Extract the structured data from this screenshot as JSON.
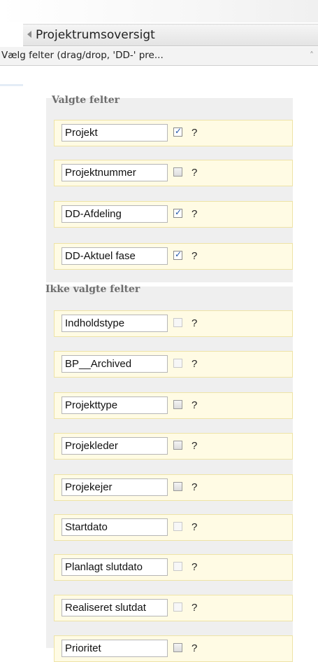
{
  "pane": {
    "title": "Projektrumsoversigt",
    "subtitle": "Vælg felter (drag/drop, 'DD-' pre..."
  },
  "selected_section": {
    "label": "Valgte felter",
    "fields": [
      {
        "name": "Projekt",
        "checked": true
      },
      {
        "name": "Projektnummer",
        "checked": false
      },
      {
        "name": "DD-Afdeling",
        "checked": true
      },
      {
        "name": "DD-Aktuel fase",
        "checked": true
      }
    ]
  },
  "unselected_section": {
    "label": "Ikke valgte felter",
    "fields": [
      {
        "name": "Indholdstype",
        "checked": false,
        "disabled": true
      },
      {
        "name": "BP__Archived",
        "checked": false,
        "disabled": true
      },
      {
        "name": "Projekttype",
        "checked": false
      },
      {
        "name": "Projekleder",
        "checked": false
      },
      {
        "name": "Projekejer",
        "checked": false
      },
      {
        "name": "Startdato",
        "checked": false,
        "disabled": true
      },
      {
        "name": "Planlagt slutdato",
        "checked": false,
        "disabled": true
      },
      {
        "name": "Realiseret slutdat",
        "checked": false,
        "disabled": true
      },
      {
        "name": "Prioritet",
        "checked": false
      }
    ]
  },
  "help_label": "?",
  "colors": {
    "row_background": "#fffbe4",
    "row_border": "#eee3a6",
    "group_background": "#efefef",
    "check_color": "#2356a8"
  }
}
